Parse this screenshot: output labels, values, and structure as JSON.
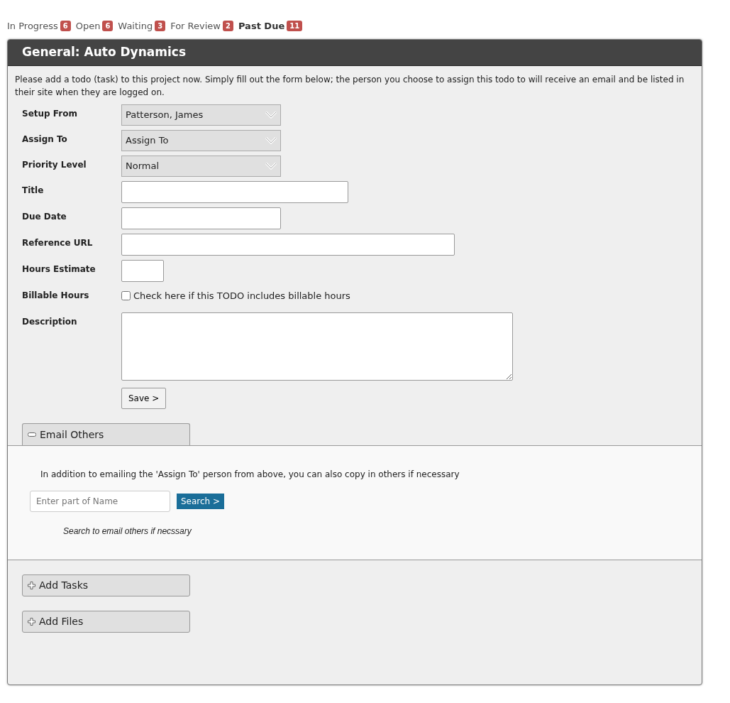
{
  "status_tabs": [
    {
      "label": "In Progress",
      "count": "6",
      "selected": false
    },
    {
      "label": "Open",
      "count": "6",
      "selected": false
    },
    {
      "label": "Waiting",
      "count": "3",
      "selected": false
    },
    {
      "label": "For Review",
      "count": "2",
      "selected": false
    },
    {
      "label": "Past Due",
      "count": "11",
      "selected": true
    }
  ],
  "panel": {
    "title": "General: Auto Dynamics",
    "intro": "Please add a todo (task) to this project now. Simply fill out the form below; the person you choose to assign this todo to will receive an email and be listed in their site when they are logged on.",
    "fields": [
      {
        "kind": "select",
        "label": "Setup From",
        "value": "Patterson, James"
      },
      {
        "kind": "select",
        "label": "Assign To",
        "value": "Assign To"
      },
      {
        "kind": "select",
        "label": "Priority Level",
        "value": "Normal"
      },
      {
        "kind": "text",
        "label": "Title"
      },
      {
        "kind": "text",
        "label": "Due Date"
      },
      {
        "kind": "text",
        "label": "Reference URL"
      },
      {
        "kind": "text",
        "label": "Hours Estimate"
      },
      {
        "kind": "checkbox",
        "label": "Billable Hours",
        "text": "Check here if this TODO includes billable hours",
        "checked": false
      },
      {
        "kind": "textarea",
        "label": "Description"
      }
    ],
    "save_button": "Save >",
    "sections": [
      {
        "title": "Email Others",
        "expanded": true,
        "note": "In addition to emailing the 'Assign To' person from above, you can also copy in others if necessary",
        "search": {
          "placeholder": "Enter part of Name",
          "button": "Search >"
        },
        "hint": "Search to email others if necssary"
      },
      {
        "title": "Add Tasks",
        "expanded": false
      },
      {
        "title": "Add Files",
        "expanded": false
      }
    ]
  }
}
